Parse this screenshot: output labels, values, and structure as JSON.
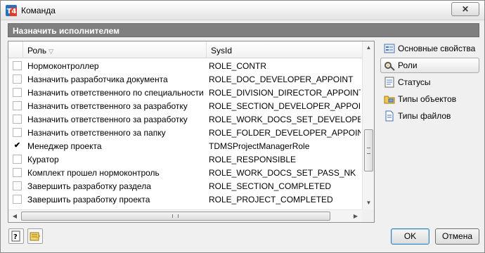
{
  "window": {
    "title": "Команда",
    "close_glyph": "✕",
    "app_icon": "t4-app-icon"
  },
  "section": {
    "title": "Назначить исполнителем"
  },
  "grid": {
    "columns": {
      "role": "Роль",
      "sysid": "SysId"
    },
    "rows": [
      {
        "checked": false,
        "role": "Нормоконтроллер",
        "sysid": "ROLE_CONTR"
      },
      {
        "checked": false,
        "role": "Назначить разработчика документа",
        "sysid": "ROLE_DOC_DEVELOPER_APPOINT"
      },
      {
        "checked": false,
        "role": "Назначить ответственного по специальности",
        "sysid": "ROLE_DIVISION_DIRECTOR_APPOINT"
      },
      {
        "checked": false,
        "role": "Назначить ответственного за разработку",
        "sysid": "ROLE_SECTION_DEVELOPER_APPOINT"
      },
      {
        "checked": false,
        "role": "Назначить ответственного за разработку",
        "sysid": "ROLE_WORK_DOCS_SET_DEVELOPER"
      },
      {
        "checked": false,
        "role": "Назначить ответственного за папку",
        "sysid": "ROLE_FOLDER_DEVELOPER_APPOINT"
      },
      {
        "checked": true,
        "role": "Менеджер проекта",
        "sysid": "TDMSProjectManagerRole"
      },
      {
        "checked": false,
        "role": "Куратор",
        "sysid": "ROLE_RESPONSIBLE"
      },
      {
        "checked": false,
        "role": "Комплект прошел нормоконтроль",
        "sysid": "ROLE_WORK_DOCS_SET_PASS_NK"
      },
      {
        "checked": false,
        "role": "Завершить разработку раздела",
        "sysid": "ROLE_SECTION_COMPLETED"
      },
      {
        "checked": false,
        "role": "Завершить разработку проекта",
        "sysid": "ROLE_PROJECT_COMPLETED"
      }
    ]
  },
  "nav": {
    "items": [
      {
        "label": "Основные свойства",
        "icon": "properties-icon",
        "selected": false
      },
      {
        "label": "Роли",
        "icon": "roles-icon",
        "selected": true
      },
      {
        "label": "Статусы",
        "icon": "statuses-icon",
        "selected": false
      },
      {
        "label": "Типы объектов",
        "icon": "object-types-icon",
        "selected": false
      },
      {
        "label": "Типы файлов",
        "icon": "file-types-icon",
        "selected": false
      }
    ]
  },
  "buttons": {
    "ok": "OK",
    "cancel": "Отмена"
  },
  "colors": {
    "header_bg": "#7f7f7f",
    "accent": "#3c7fb1"
  }
}
